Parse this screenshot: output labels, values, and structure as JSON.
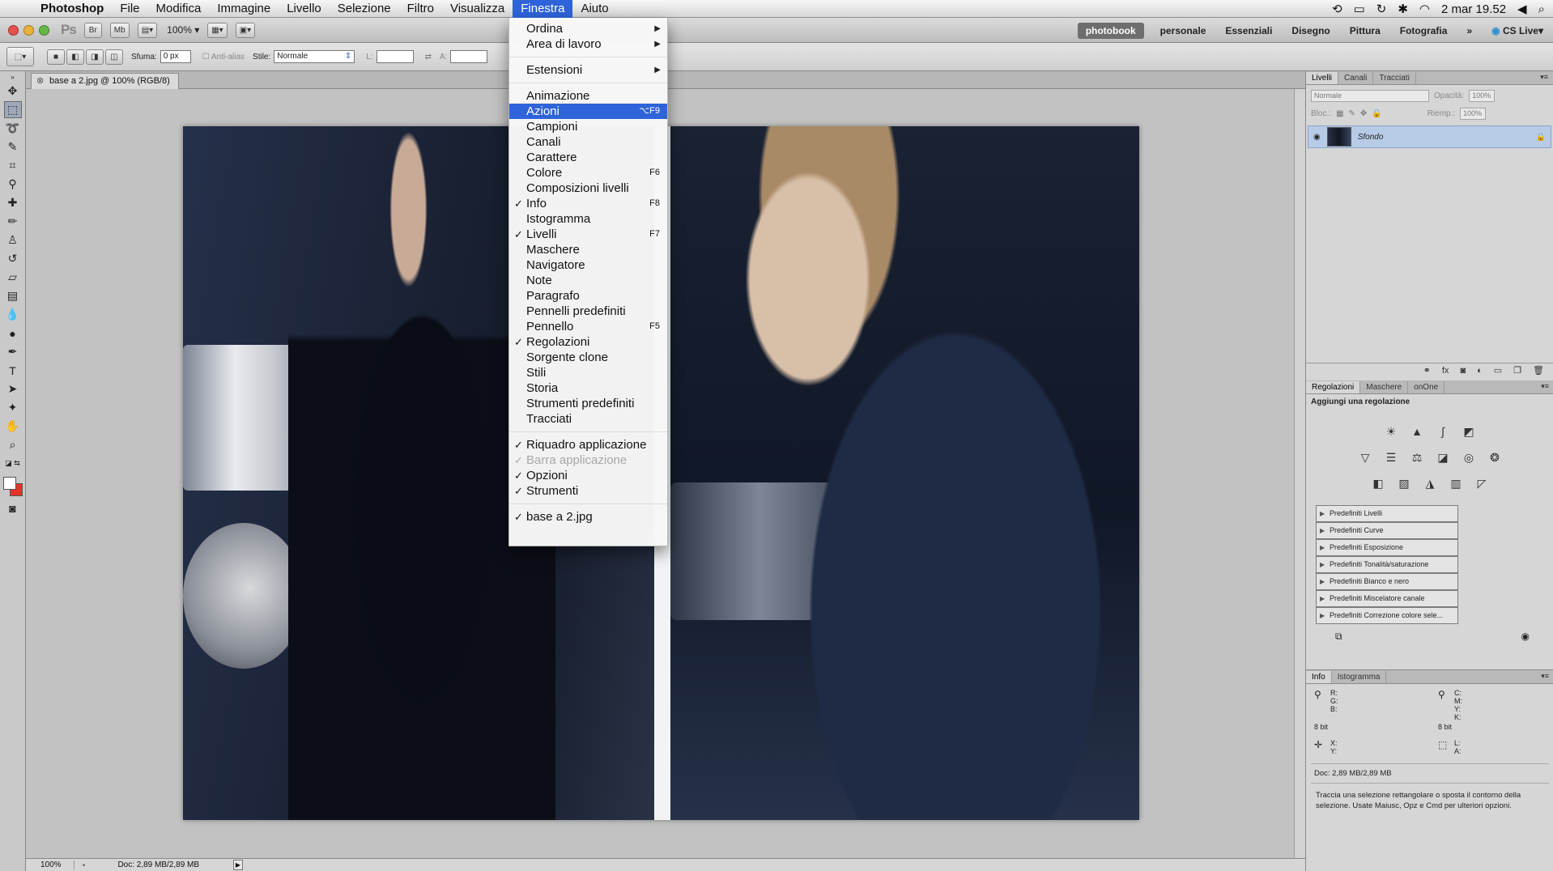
{
  "menubar": {
    "app": "Photoshop",
    "items": [
      "File",
      "Modifica",
      "Immagine",
      "Livello",
      "Selezione",
      "Filtro",
      "Visualizza",
      "Finestra",
      "Aiuto"
    ],
    "active": "Finestra",
    "clock": "2 mar  19.52"
  },
  "appbar": {
    "logo": "Ps",
    "btn_br": "Br",
    "btn_mb": "Mb",
    "zoom": "100%",
    "workspaces": [
      "photobook",
      "personale",
      "Essenziali",
      "Disegno",
      "Pittura",
      "Fotografia"
    ],
    "workspace_selected": "photobook",
    "more": "»",
    "cs_live": "CS Live"
  },
  "options": {
    "sfuma_label": "Sfuma:",
    "sfuma_value": "0 px",
    "antialias": "Anti-alias",
    "stile_label": "Stile:",
    "stile_value": "Normale",
    "l_label": "L:",
    "a_label": "A:"
  },
  "document": {
    "tab_title": "base a 2.jpg @ 100% (RGB/8)",
    "status_zoom": "100%",
    "status_doc": "Doc: 2,89 MB/2,89 MB"
  },
  "finestra_menu": {
    "groups": [
      [
        {
          "label": "Ordina",
          "submenu": true
        },
        {
          "label": "Area di lavoro",
          "submenu": true
        }
      ],
      [
        {
          "label": "Estensioni",
          "submenu": true
        }
      ],
      [
        {
          "label": "Animazione"
        },
        {
          "label": "Azioni",
          "shortcut": "⌥F9",
          "highlighted": true
        },
        {
          "label": "Campioni"
        },
        {
          "label": "Canali"
        },
        {
          "label": "Carattere"
        },
        {
          "label": "Colore",
          "shortcut": "F6"
        },
        {
          "label": "Composizioni livelli"
        },
        {
          "label": "Info",
          "shortcut": "F8",
          "checked": true
        },
        {
          "label": "Istogramma"
        },
        {
          "label": "Livelli",
          "shortcut": "F7",
          "checked": true
        },
        {
          "label": "Maschere"
        },
        {
          "label": "Navigatore"
        },
        {
          "label": "Note"
        },
        {
          "label": "Paragrafo"
        },
        {
          "label": "Pennelli predefiniti"
        },
        {
          "label": "Pennello",
          "shortcut": "F5"
        },
        {
          "label": "Regolazioni",
          "checked": true
        },
        {
          "label": "Sorgente clone"
        },
        {
          "label": "Stili"
        },
        {
          "label": "Storia"
        },
        {
          "label": "Strumenti predefiniti"
        },
        {
          "label": "Tracciati"
        }
      ],
      [
        {
          "label": "Riquadro applicazione",
          "checked": true
        },
        {
          "label": "Barra applicazione",
          "checked": true,
          "disabled": true
        },
        {
          "label": "Opzioni",
          "checked": true
        },
        {
          "label": "Strumenti",
          "checked": true
        }
      ],
      [
        {
          "label": "base a 2.jpg",
          "checked": true
        }
      ]
    ]
  },
  "layers_panel": {
    "tabs": [
      "Livelli",
      "Canali",
      "Tracciati"
    ],
    "blend_mode": "Normale",
    "opacity_label": "Opacità:",
    "opacity_value": "100%",
    "lock_label": "Bloc.:",
    "fill_label": "Riemp.:",
    "fill_value": "100%",
    "layer_name": "Sfondo"
  },
  "adjustments_panel": {
    "tabs": [
      "Regolazioni",
      "Maschere",
      "onOne"
    ],
    "title": "Aggiungi una regolazione",
    "presets": [
      "Predefiniti Livelli",
      "Predefiniti Curve",
      "Predefiniti Esposizione",
      "Predefiniti Tonalità/saturazione",
      "Predefiniti Bianco e nero",
      "Predefiniti Miscelatore canale",
      "Predefiniti Correzione colore sele..."
    ]
  },
  "info_panel": {
    "tabs": [
      "Info",
      "Istogramma"
    ],
    "rgb_labels": "R:\nG:\nB:",
    "cmyk_labels": "C:\nM:\nY:\nK:",
    "bit_left": "8 bit",
    "bit_right": "8 bit",
    "xy_labels": "X:\nY:",
    "la_labels": "L:\nA:",
    "doc": "Doc: 2,89 MB/2,89 MB",
    "hint": "Traccia una selezione rettangolare o sposta il contorno della selezione. Usate Maiusc, Opz e Cmd per ulteriori opzioni."
  }
}
